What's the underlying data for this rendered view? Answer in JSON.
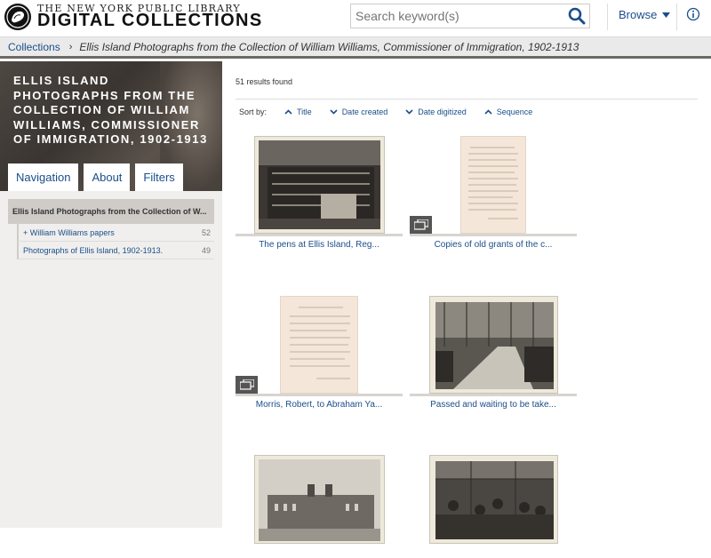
{
  "header": {
    "logo_top": "THE NEW YORK PUBLIC LIBRARY",
    "logo_bottom": "DIGITAL COLLECTIONS",
    "search_placeholder": "Search keyword(s)",
    "browse_label": "Browse",
    "accent": "#1a4e8a"
  },
  "breadcrumb": {
    "root": "Collections",
    "current": "Ellis Island Photographs from the Collection of William Williams, Commissioner of Immigration, 1902-1913"
  },
  "sidebar": {
    "banner_title": "Ellis Island Photographs from the Collection of William Williams, Commissioner of Immigration, 1902-1913",
    "tabs": [
      {
        "label": "Navigation"
      },
      {
        "label": "About"
      },
      {
        "label": "Filters"
      }
    ],
    "nav": {
      "head": "Ellis Island Photographs from the Collection of W...",
      "items": [
        {
          "label": "+ William Williams papers",
          "count": "52"
        },
        {
          "label": "Photographs of Ellis Island, 1902-1913.",
          "count": "49"
        }
      ]
    }
  },
  "main": {
    "results": "51 results found",
    "sort_label": "Sort by:",
    "sort_options": [
      {
        "label": "Title"
      },
      {
        "label": "Date created"
      },
      {
        "label": "Date digitized"
      },
      {
        "label": "Sequence"
      }
    ],
    "items": [
      {
        "caption": "The pens at Ellis Island, Reg..."
      },
      {
        "caption": "Copies of old grants of the c..."
      },
      {
        "caption": "Morris, Robert, to Abraham Ya..."
      },
      {
        "caption": "Passed and waiting to be take..."
      },
      {
        "caption": ""
      },
      {
        "caption": ""
      }
    ]
  }
}
